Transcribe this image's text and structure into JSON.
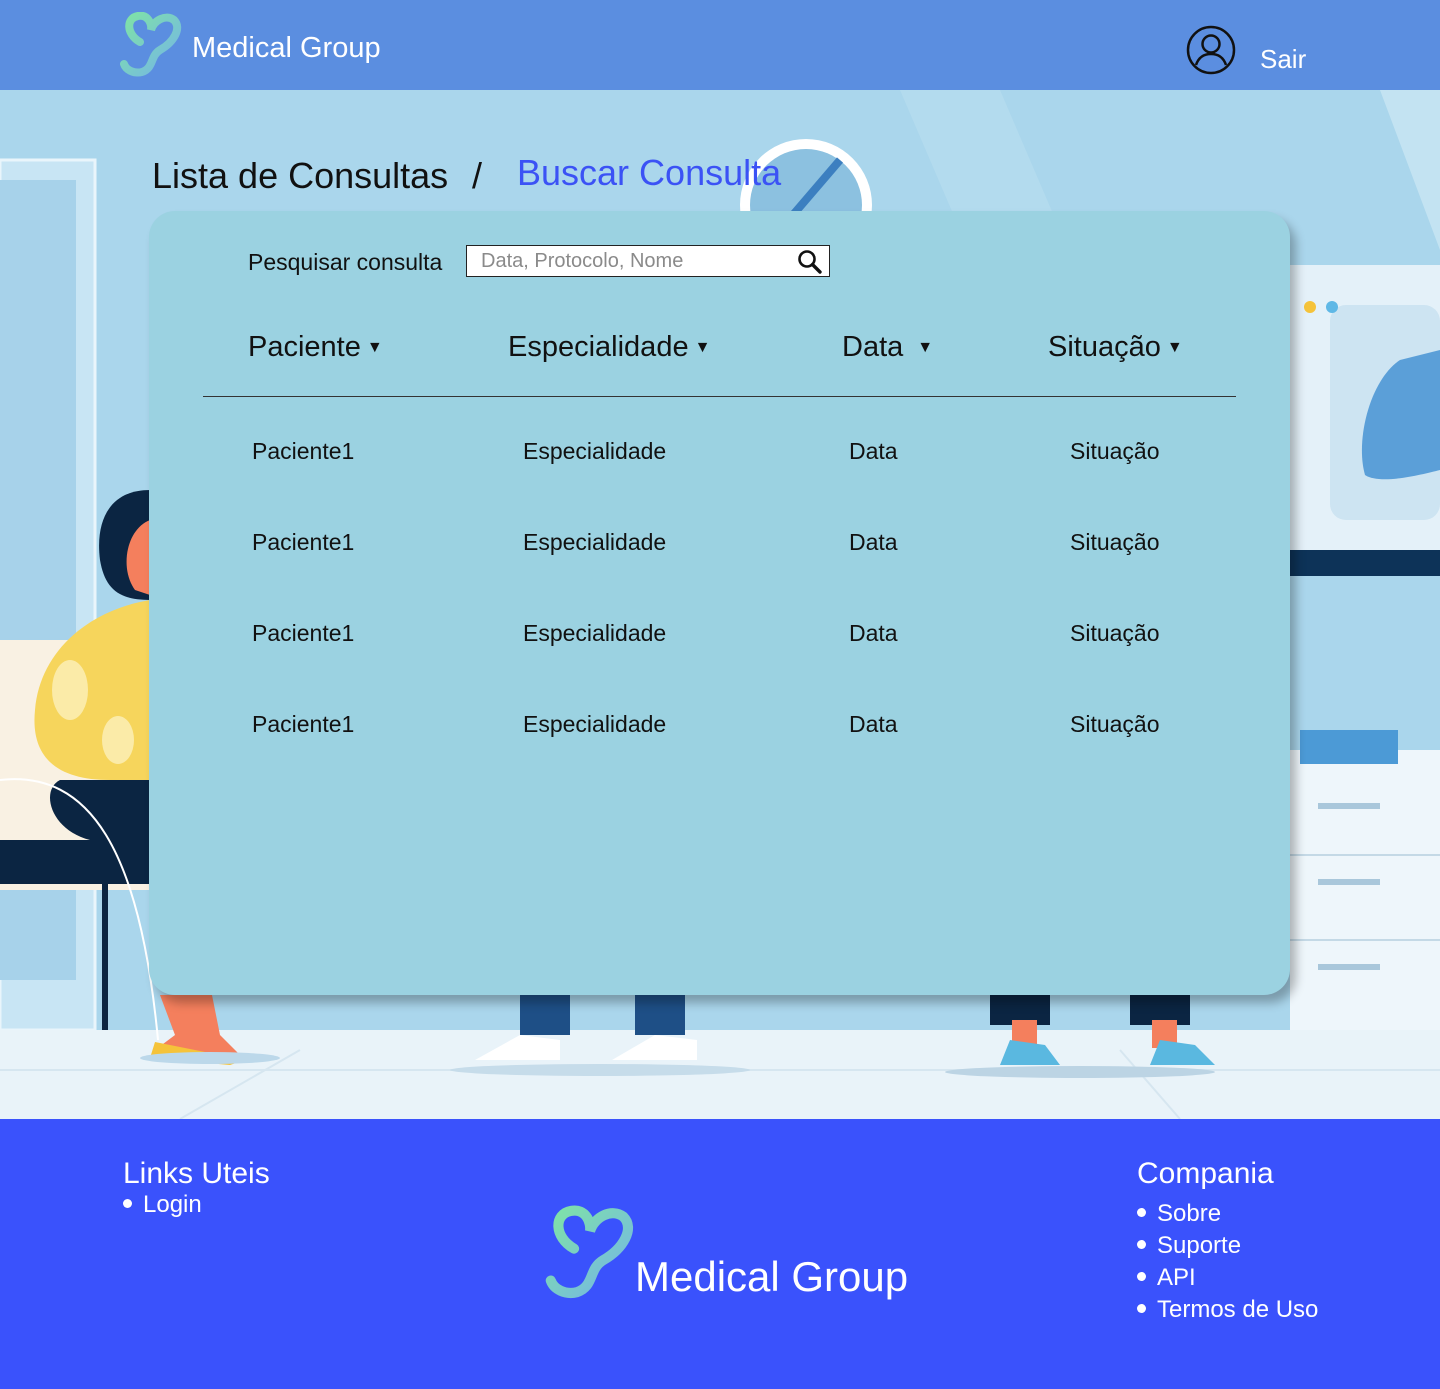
{
  "header": {
    "brand": "Medical Group",
    "logout_label": "Sair"
  },
  "breadcrumb": {
    "current": "Lista de Consultas",
    "separator": "/",
    "link": "Buscar Consulta"
  },
  "search": {
    "label": "Pesquisar consulta",
    "placeholder": "Data, Protocolo, Nome"
  },
  "table": {
    "columns": [
      "Paciente",
      "Especialidade",
      "Data",
      "Situação"
    ],
    "rows": [
      [
        "Paciente1",
        "Especialidade",
        "Data",
        "Situação"
      ],
      [
        "Paciente1",
        "Especialidade",
        "Data",
        "Situação"
      ],
      [
        "Paciente1",
        "Especialidade",
        "Data",
        "Situação"
      ],
      [
        "Paciente1",
        "Especialidade",
        "Data",
        "Situação"
      ]
    ]
  },
  "footer": {
    "links_title": "Links Uteis",
    "links": [
      "Login"
    ],
    "brand": "Medical Group",
    "company_title": "Compania",
    "company_links": [
      "Sobre",
      "Suporte",
      "API",
      "Termos de Uso"
    ]
  },
  "icons": {
    "logo": "heart-logo-icon",
    "user": "user-circle-icon",
    "search": "magnifier-icon",
    "sort": "triangle-down-icon"
  },
  "colors": {
    "header": "#5b8ee0",
    "panel": "#9bd2e1",
    "accent_link": "#3b52f5",
    "footer": "#3a52fc"
  }
}
